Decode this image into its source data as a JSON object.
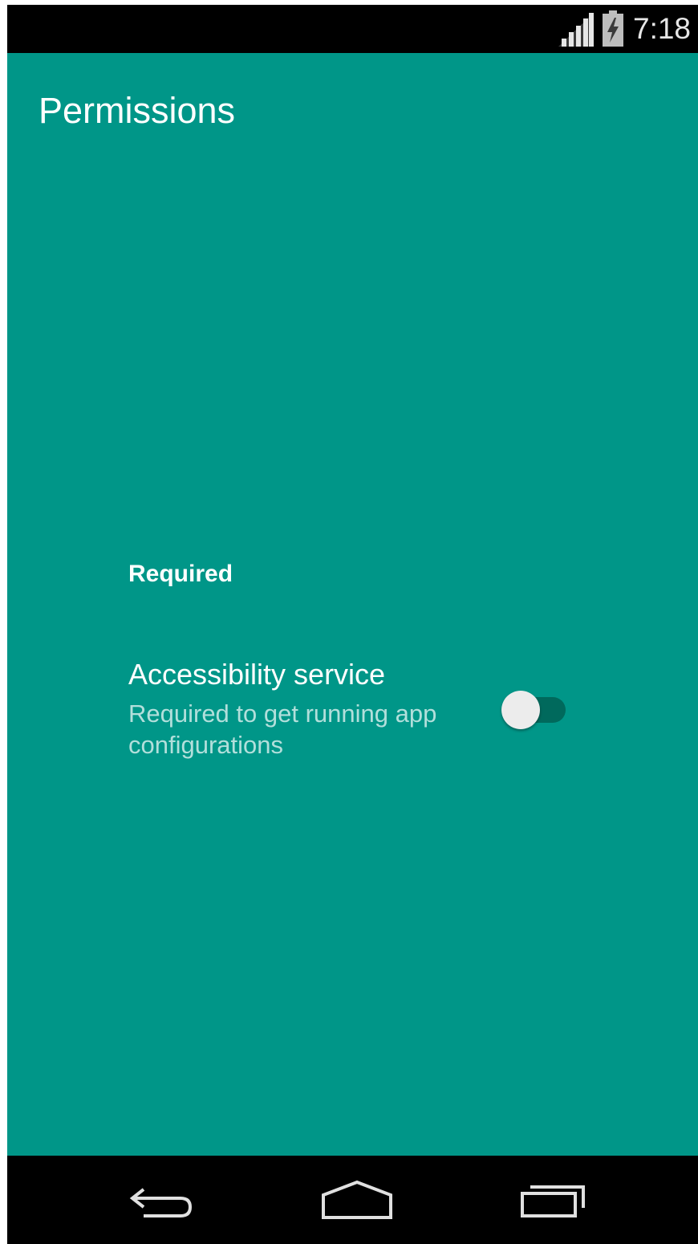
{
  "status_bar": {
    "time": "7:18",
    "icons": [
      "signal-icon",
      "battery-charging-icon"
    ]
  },
  "header": {
    "title": "Permissions"
  },
  "section": {
    "header": "Required"
  },
  "preference": {
    "title": "Accessibility service",
    "summary": "Required to get running app configurations",
    "switch_on": false
  },
  "nav_bar": {
    "icons": [
      "back-icon",
      "home-icon",
      "recents-icon"
    ]
  },
  "colors": {
    "primary": "#009688",
    "status_bar": "#000000",
    "nav_bar": "#000000",
    "title_text": "#ffffff",
    "summary_text": "#b2dfdb",
    "switch_track": "#00695c",
    "switch_thumb": "#ececec"
  }
}
